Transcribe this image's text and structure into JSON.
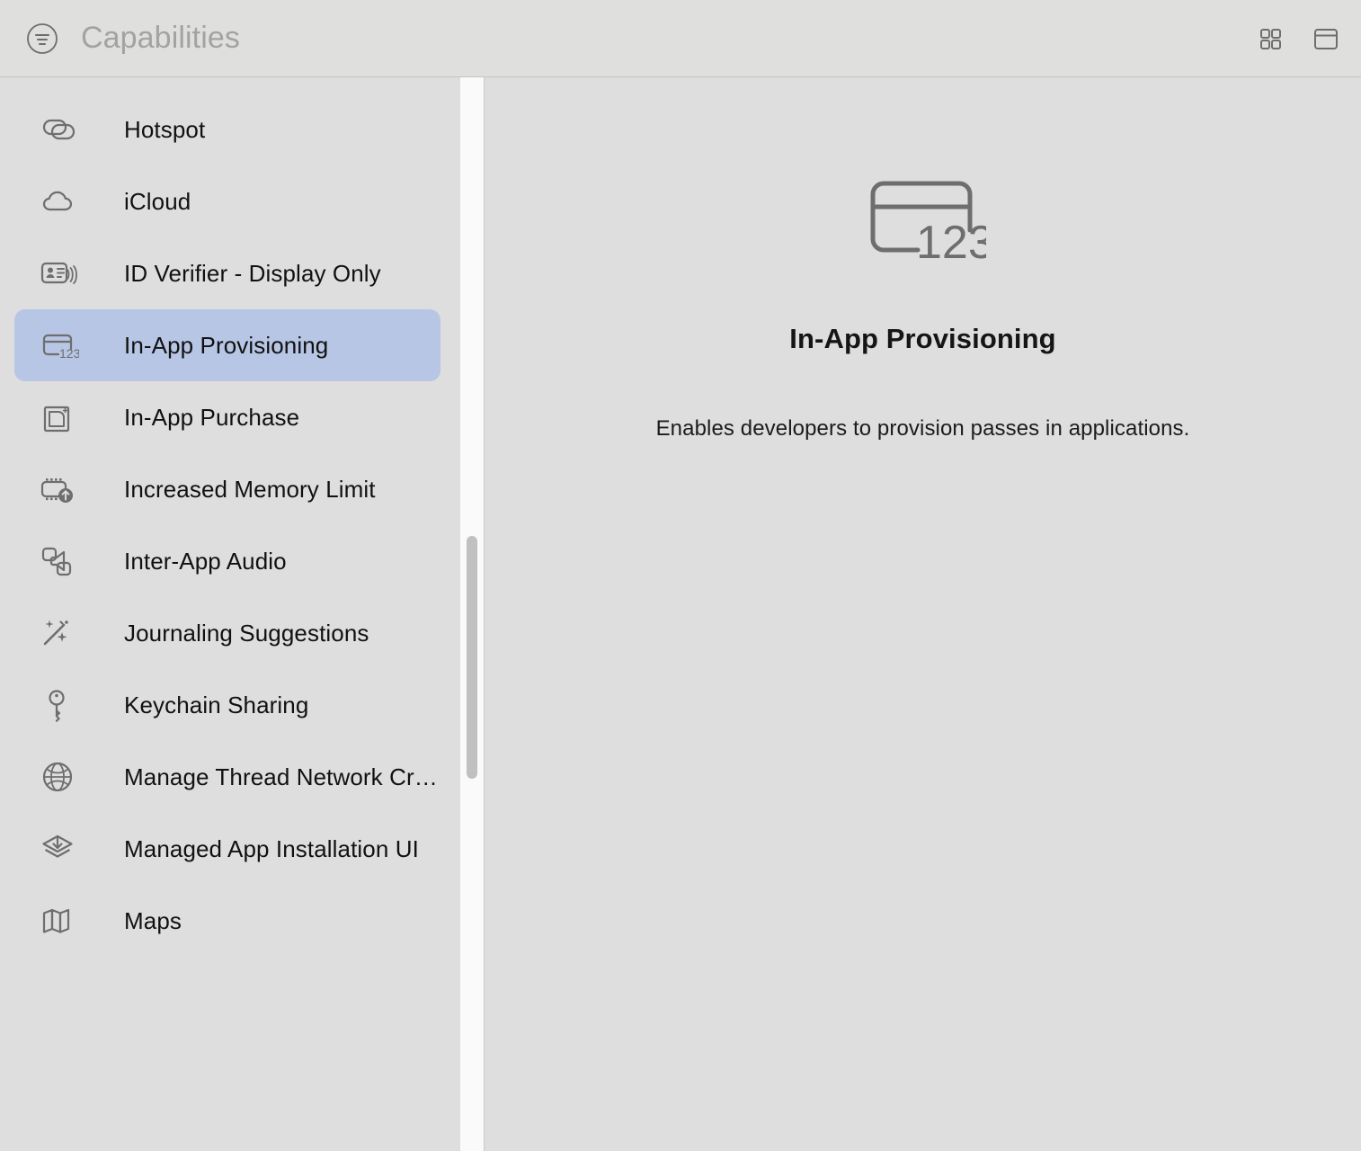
{
  "header": {
    "title": "Capabilities",
    "filter_icon": "filter-circle-icon",
    "grid_view_icon": "grid-view-icon",
    "panel_view_icon": "panel-view-icon"
  },
  "sidebar": {
    "items": [
      {
        "label": "Hotspot",
        "icon": "hotspot-link-icon",
        "selected": false
      },
      {
        "label": "iCloud",
        "icon": "cloud-icon",
        "selected": false
      },
      {
        "label": "ID Verifier - Display Only",
        "icon": "id-card-nfc-icon",
        "selected": false
      },
      {
        "label": "In-App Provisioning",
        "icon": "credit-card-123-icon",
        "selected": true
      },
      {
        "label": "In-App Purchase",
        "icon": "in-app-purchase-icon",
        "selected": false
      },
      {
        "label": "Increased Memory Limit",
        "icon": "memory-chip-up-icon",
        "selected": false
      },
      {
        "label": "Inter-App Audio",
        "icon": "inter-app-audio-icon",
        "selected": false
      },
      {
        "label": "Journaling Suggestions",
        "icon": "magic-wand-sparkles-icon",
        "selected": false
      },
      {
        "label": "Keychain Sharing",
        "icon": "key-icon",
        "selected": false
      },
      {
        "label": "Manage Thread Network Cre…",
        "icon": "globe-icon",
        "selected": false
      },
      {
        "label": "Managed App Installation UI",
        "icon": "layers-download-icon",
        "selected": false
      },
      {
        "label": "Maps",
        "icon": "folded-map-icon",
        "selected": false
      }
    ]
  },
  "detail": {
    "icon": "credit-card-123-icon",
    "title": "In-App Provisioning",
    "description": "Enables developers to provision passes in applications."
  },
  "colors": {
    "background": "#dedede",
    "selection": "#b7c6e4",
    "icon_gray": "#6e6e6e",
    "title_gray": "#a3a3a3",
    "scrollbar_thumb": "#c0c0c0"
  }
}
